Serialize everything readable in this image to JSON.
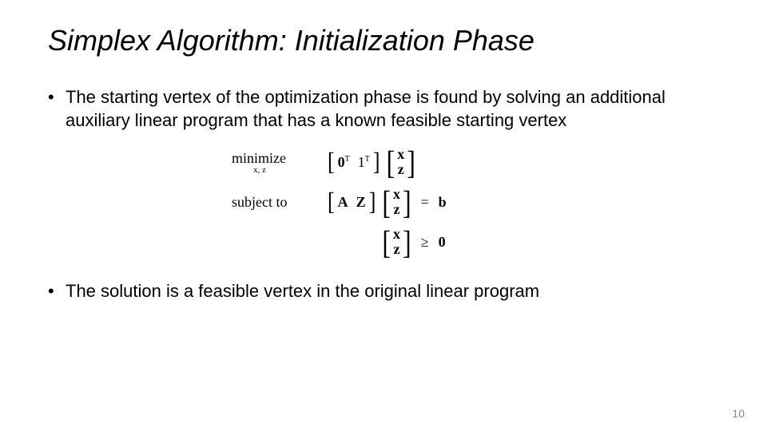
{
  "title": "Simplex Algorithm: Initialization Phase",
  "bullets": {
    "b1": "The starting vertex of the optimization phase is found by solving an additional auxiliary linear program that has a known feasible starting vertex",
    "b2": "The solution is a feasible vertex in the original linear program"
  },
  "math": {
    "minimize": "minimize",
    "min_sub": "x, z",
    "subject": "subject to",
    "zeroT": "0",
    "oneT": "1",
    "sup": "T",
    "A": "A",
    "Z": "Z",
    "x": "x",
    "z": "z",
    "eq": "=",
    "ge": "≥",
    "b": "b",
    "zero": "0"
  },
  "page_number": "10"
}
